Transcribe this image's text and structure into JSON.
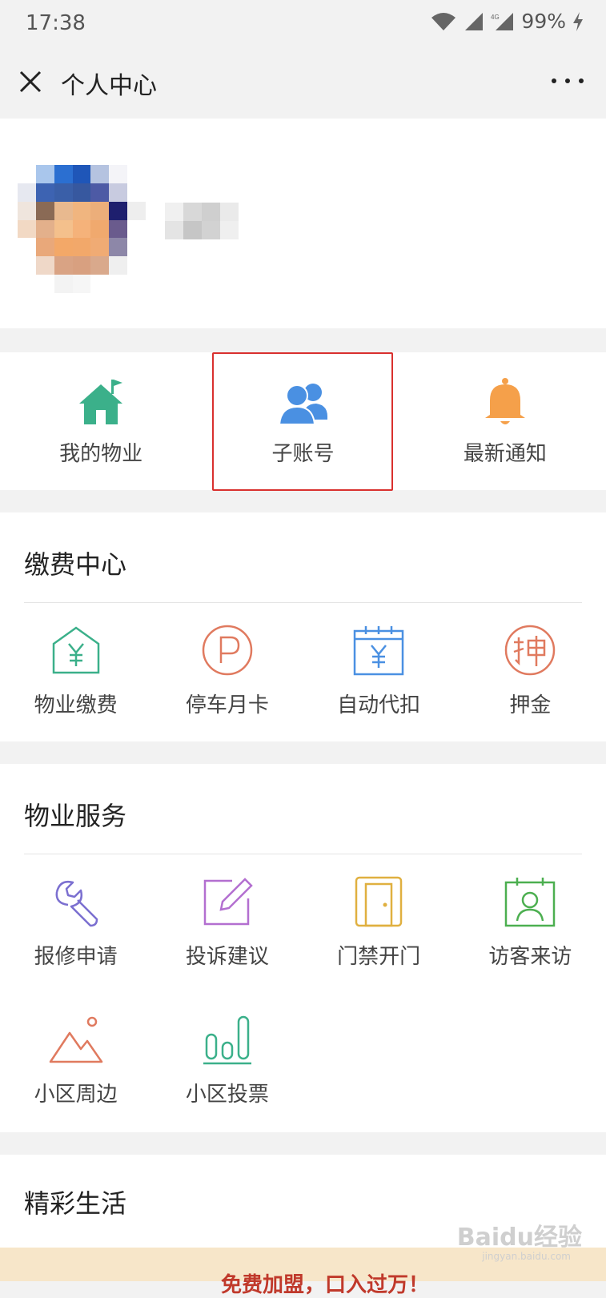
{
  "status_bar": {
    "time": "17:38",
    "battery": "99%"
  },
  "nav": {
    "title": "个人中心"
  },
  "quick_actions": [
    {
      "label": "我的物业",
      "icon": "house-icon",
      "color": "#3bb08a"
    },
    {
      "label": "子账号",
      "icon": "users-icon",
      "color": "#4a90e2"
    },
    {
      "label": "最新通知",
      "icon": "bell-icon",
      "color": "#f5a04a"
    }
  ],
  "payment": {
    "title": "缴费中心",
    "items": [
      {
        "label": "物业缴费",
        "icon": "house-yen-icon",
        "color": "#3bb08a"
      },
      {
        "label": "停车月卡",
        "icon": "parking-icon",
        "color": "#e07a5f"
      },
      {
        "label": "自动代扣",
        "icon": "calendar-yen-icon",
        "color": "#4a90e2"
      },
      {
        "label": "押金",
        "icon": "deposit-icon",
        "color": "#e07a5f"
      }
    ]
  },
  "services": {
    "title": "物业服务",
    "items": [
      {
        "label": "报修申请",
        "icon": "wrench-icon",
        "color": "#7b6fd0"
      },
      {
        "label": "投诉建议",
        "icon": "edit-icon",
        "color": "#b36fd0"
      },
      {
        "label": "门禁开门",
        "icon": "door-icon",
        "color": "#e0b040"
      },
      {
        "label": "访客来访",
        "icon": "visitor-icon",
        "color": "#4caf50"
      },
      {
        "label": "小区周边",
        "icon": "mountain-icon",
        "color": "#e07a5f"
      },
      {
        "label": "小区投票",
        "icon": "vote-chart-icon",
        "color": "#3bb08a"
      }
    ]
  },
  "life": {
    "title": "精彩生活",
    "banner_text": "免费加盟，口入过万！"
  },
  "watermark": {
    "text": "Baidu经验",
    "sub": "jingyan.baidu.com"
  }
}
